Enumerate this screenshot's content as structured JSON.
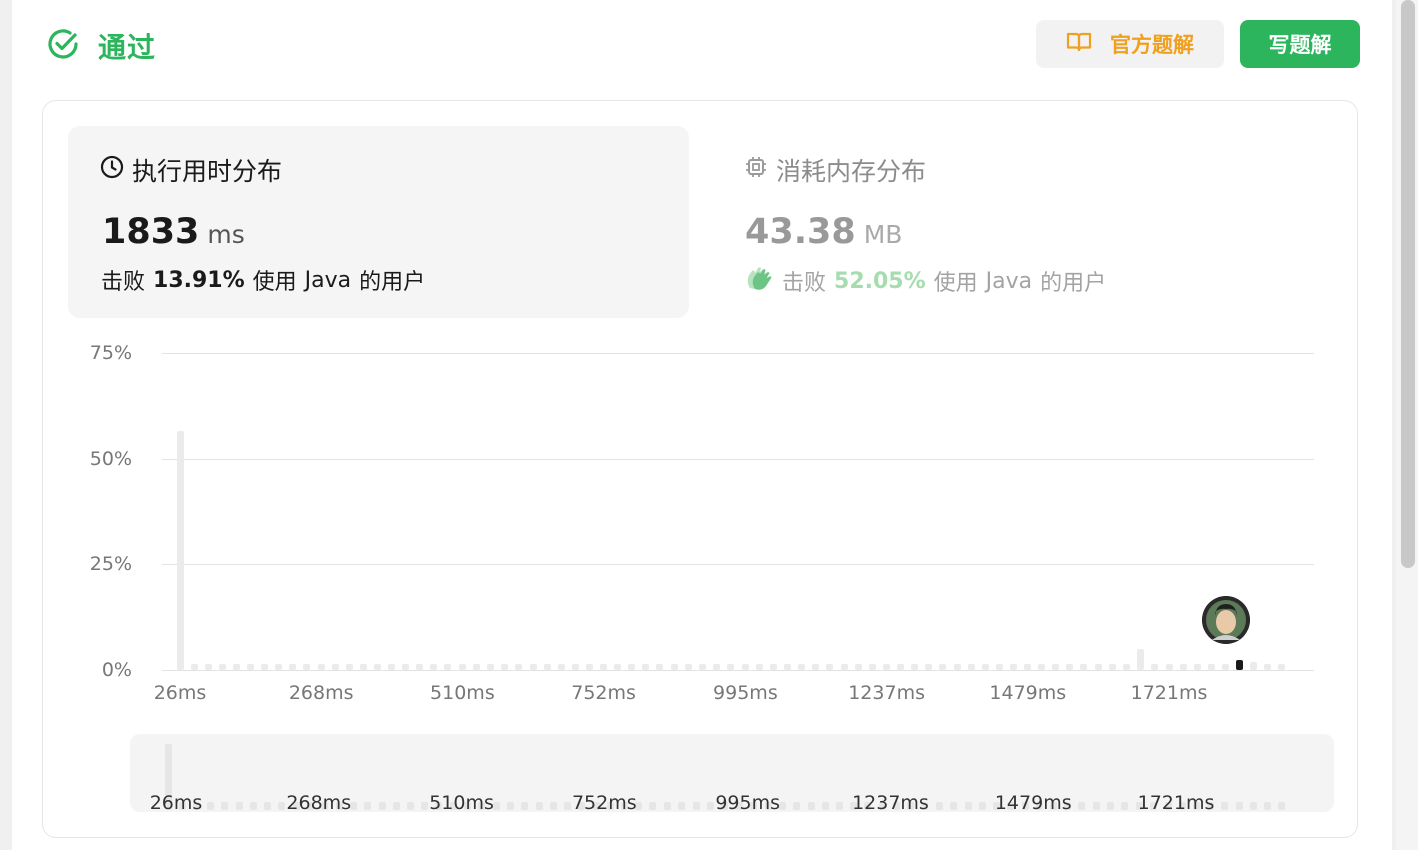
{
  "status": {
    "label": "通过",
    "color": "#2db55d",
    "icon": "check-circle-icon"
  },
  "header": {
    "official_solution_label": "官方题解",
    "official_solution_icon": "book-icon",
    "write_solution_label": "写题解"
  },
  "runtime": {
    "title": "执行用时分布",
    "icon": "clock-icon",
    "value": "1833",
    "unit": "ms",
    "beat_prefix": "击败",
    "beat_percent": "13.91%",
    "beat_suffix_1": "使用",
    "language": "Java",
    "beat_suffix_2": "的用户"
  },
  "memory": {
    "title": "消耗内存分布",
    "icon": "chip-icon",
    "value": "43.38",
    "unit": "MB",
    "beat_prefix": "击败",
    "beat_percent": "52.05%",
    "beat_suffix_1": "使用",
    "language": "Java",
    "beat_suffix_2": "的用户",
    "beat_icon": "clapping-hands-icon"
  },
  "chart_data": {
    "type": "bar",
    "title": "",
    "ylabel": "",
    "xlabel": "",
    "y_ticks": [
      "75%",
      "50%",
      "25%",
      "0%"
    ],
    "ylim": [
      0,
      75
    ],
    "x_tick_labels": [
      "26ms",
      "268ms",
      "510ms",
      "752ms",
      "995ms",
      "1237ms",
      "1479ms",
      "1721ms"
    ],
    "x_ticks_ms": [
      26,
      268,
      510,
      752,
      995,
      1237,
      1479,
      1721
    ],
    "xlim_ms": [
      26,
      1926
    ],
    "bins_ms": [
      26,
      50,
      74,
      98,
      122,
      147,
      171,
      195,
      219,
      243,
      268,
      292,
      316,
      340,
      364,
      389,
      413,
      437,
      461,
      485,
      510,
      534,
      558,
      582,
      606,
      631,
      655,
      679,
      703,
      727,
      752,
      776,
      800,
      824,
      848,
      873,
      897,
      921,
      945,
      969,
      995,
      1019,
      1043,
      1067,
      1091,
      1116,
      1140,
      1164,
      1188,
      1212,
      1237,
      1261,
      1285,
      1309,
      1333,
      1358,
      1382,
      1406,
      1430,
      1454,
      1479,
      1503,
      1527,
      1551,
      1575,
      1600,
      1624,
      1648,
      1672,
      1696,
      1721,
      1745,
      1769,
      1793,
      1817,
      1842,
      1866,
      1890,
      1914
    ],
    "values_percent": [
      56.6,
      0.8,
      0.8,
      0.8,
      0.8,
      0.8,
      0.8,
      0.8,
      0.8,
      0.8,
      0.8,
      0.8,
      0.8,
      0.8,
      0.8,
      0.8,
      0.8,
      0.8,
      0.8,
      0.8,
      0.8,
      0.8,
      0.8,
      0.8,
      0.8,
      0.8,
      0.8,
      0.8,
      0.8,
      0.8,
      0.8,
      0.8,
      0.8,
      0.8,
      0.8,
      0.8,
      0.8,
      0.8,
      0.8,
      0.8,
      0.8,
      0.8,
      0.8,
      0.8,
      0.8,
      0.8,
      0.8,
      0.8,
      0.8,
      0.8,
      0.8,
      0.8,
      0.8,
      0.8,
      0.8,
      0.8,
      0.8,
      0.8,
      0.8,
      0.8,
      0.8,
      0.8,
      0.8,
      0.8,
      0.8,
      0.8,
      0.8,
      0.8,
      5.0,
      0.8,
      0.8,
      0.8,
      0.8,
      0.8,
      0.8,
      0.8,
      2.0,
      0.8,
      0.8
    ],
    "highlight_bin_index": 75,
    "grid": true,
    "legend": "none",
    "bar_color": "#ebebeb",
    "highlight_color": "#1a1a1a"
  },
  "minimap": {
    "x_tick_labels": [
      "26ms",
      "268ms",
      "510ms",
      "752ms",
      "995ms",
      "1237ms",
      "1479ms",
      "1721ms"
    ]
  }
}
